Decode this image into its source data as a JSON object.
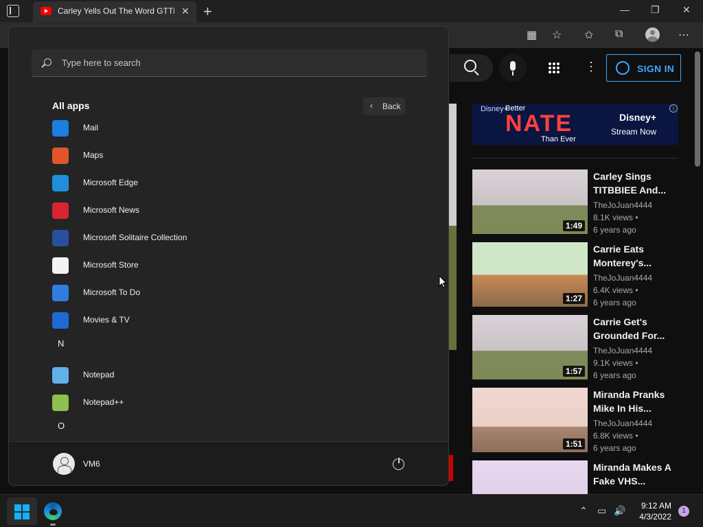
{
  "browser": {
    "tab_title": "Carley Yells Out The Word GTTP",
    "tab_close": "✕",
    "new_tab": "+",
    "minimize": "—",
    "restore": "❐",
    "close": "✕"
  },
  "youtube": {
    "sign_in": "SIGN IN",
    "ad": {
      "brand": "Disney+",
      "tagline_1": "Better",
      "headline": "NATE",
      "tagline_2": "Than Ever",
      "logo": "Disney+",
      "cta": "Stream Now"
    },
    "videos": [
      {
        "title": "Carley Sings TITBBIEE And...",
        "channel": "TheJoJuan4444",
        "views": "8.1K views •",
        "age": "6 years ago",
        "duration": "1:49"
      },
      {
        "title": "Carrie Eats Monterey's...",
        "channel": "TheJoJuan4444",
        "views": "6.4K views •",
        "age": "6 years ago",
        "duration": "1:27"
      },
      {
        "title": "Carrie Get's Grounded For...",
        "channel": "TheJoJuan4444",
        "views": "9.1K views •",
        "age": "6 years ago",
        "duration": "1:57"
      },
      {
        "title": "Miranda Pranks Mike In His...",
        "channel": "TheJoJuan4444",
        "views": "6.8K views •",
        "age": "6 years ago",
        "duration": "1:51"
      },
      {
        "title": "Miranda Makes A Fake VHS...",
        "channel": "",
        "views": "",
        "age": "",
        "duration": ""
      }
    ]
  },
  "start_menu": {
    "search_placeholder": "Type here to search",
    "heading": "All apps",
    "back": "Back",
    "apps": [
      {
        "label": "Mail",
        "icon": "mail-icon",
        "color": "#1b7fe0"
      },
      {
        "label": "Maps",
        "icon": "maps-icon",
        "color": "#e0552c"
      },
      {
        "label": "Microsoft Edge",
        "icon": "edge-icon",
        "color": "#1f8fdb"
      },
      {
        "label": "Microsoft News",
        "icon": "news-icon",
        "color": "#d8262f"
      },
      {
        "label": "Microsoft Solitaire Collection",
        "icon": "solitaire-icon",
        "color": "#2a4f9c"
      },
      {
        "label": "Microsoft Store",
        "icon": "store-icon",
        "color": "#f3f3f3"
      },
      {
        "label": "Microsoft To Do",
        "icon": "todo-icon",
        "color": "#2f7de1"
      },
      {
        "label": "Movies & TV",
        "icon": "movies-icon",
        "color": "#1d6ad6"
      }
    ],
    "letter_n": "N",
    "apps_n": [
      {
        "label": "Notepad",
        "icon": "notepad-icon",
        "color": "#5fb2e8"
      },
      {
        "label": "Notepad++",
        "icon": "notepadpp-icon",
        "color": "#8fc04e"
      }
    ],
    "letter_o": "O",
    "user": "VM6"
  },
  "taskbar": {
    "time": "9:12 AM",
    "date": "4/3/2022",
    "notifications": "1"
  }
}
